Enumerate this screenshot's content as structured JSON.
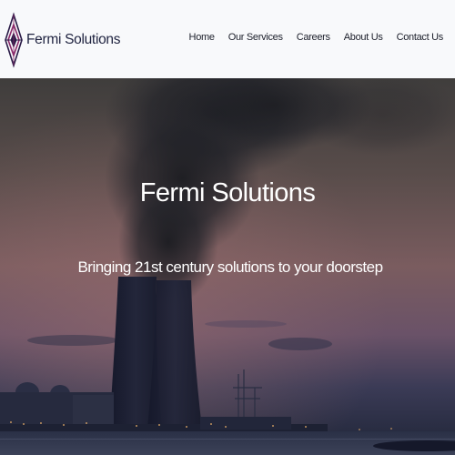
{
  "header": {
    "brand_name": "Fermi Solutions",
    "brand_colors": {
      "diamond_dark": "#2a1b47",
      "diamond_accent": "#8a2a6a"
    },
    "nav": [
      {
        "label": "Home"
      },
      {
        "label": "Our Services"
      },
      {
        "label": "Careers"
      },
      {
        "label": "About Us"
      },
      {
        "label": "Contact Us"
      }
    ]
  },
  "hero": {
    "title": "Fermi Solutions",
    "subtitle": "Bringing 21st century solutions to your doorstep",
    "background_image": "cooling towers emitting smoke at dusk"
  }
}
